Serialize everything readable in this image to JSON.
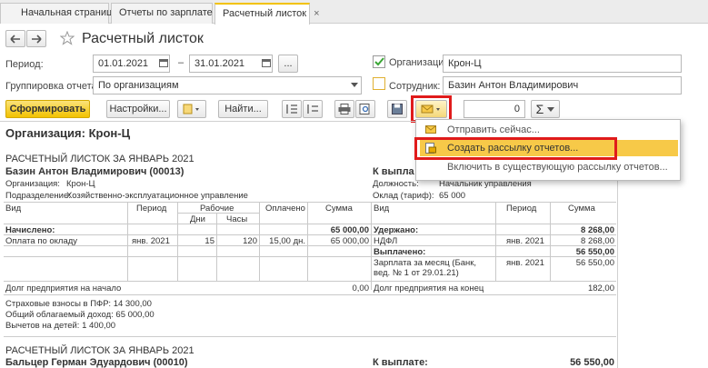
{
  "tabs": [
    {
      "label": "Начальная страница"
    },
    {
      "label": "Отчеты по зарплате"
    },
    {
      "label": "Расчетный листок"
    }
  ],
  "tab_close_glyph": "×",
  "title": "Расчетный листок",
  "form": {
    "period_label": "Период:",
    "date_from": "01.01.2021",
    "dash": "–",
    "date_to": "31.01.2021",
    "ellipsis": "...",
    "grouping_label": "Группировка отчета:",
    "grouping_value": "По организациям",
    "org_label": "Организация:",
    "org_value": "Крон-Ц",
    "org_checked": true,
    "employee_label": "Сотрудник:",
    "employee_value": "Базин Антон Владимирович"
  },
  "toolbar": {
    "generate": "Сформировать",
    "settings": "Настройки...",
    "find": "Найти...",
    "number_value": "0",
    "sigma": "Σ"
  },
  "menu": {
    "items": [
      {
        "label": "Отправить сейчас..."
      },
      {
        "label": "Создать рассылку отчетов..."
      },
      {
        "label": "Включить в существующую рассылку отчетов..."
      }
    ]
  },
  "report": {
    "org_header": "Организация: Крон-Ц",
    "sheet1": {
      "title": "РАСЧЕТНЫЙ ЛИСТОК ЗА ЯНВАРЬ 2021",
      "employee": "Базин Антон Владимирович (00013)",
      "to_pay_label": "К выпла",
      "org_label": "Организация:",
      "org_value": "Крон-Ц",
      "dept_label": "Подразделение:",
      "dept_value": "Хозяйственно-эксплуатационное управление",
      "position_label": "Должность:",
      "position_value": "Начальник управления",
      "salary_label": "Оклад (тариф):",
      "salary_value": "65 000",
      "headers": {
        "kind": "Вид",
        "period": "Период",
        "working": "Рабочие",
        "days": "Дни",
        "hours": "Часы",
        "paid": "Оплачено",
        "sum": "Сумма",
        "kind2": "Вид",
        "period2": "Период",
        "sum2": "Сумма"
      },
      "accrued_label": "Начислено:",
      "accrued_sum": "65 000,00",
      "withheld_label": "Удержано:",
      "withheld_sum": "8 268,00",
      "row1": {
        "kind": "Оплата по окладу",
        "period": "янв. 2021",
        "days": "15",
        "hours": "120",
        "paid": "15,00 дн.",
        "sum": "65 000,00"
      },
      "ndfl": {
        "kind": "НДФЛ",
        "period": "янв. 2021",
        "sum": "8 268,00"
      },
      "paid_label": "Выплачено:",
      "paid_sum": "56 550,00",
      "salary_month_1": "Зарплата за месяц (Банк,",
      "salary_month_2": "вед. № 1 от 29.01.21)",
      "salary_month_period": "янв. 2021",
      "salary_month_sum": "56 550,00",
      "debt_start_label": "Долг предприятия на начало",
      "debt_start_sum": "0,00",
      "debt_end_label": "Долг предприятия на конец",
      "debt_end_sum": "182,00",
      "pfr": "Страховые взносы в ПФР: 14 300,00",
      "taxable": "Общий облагаемый доход: 65 000,00",
      "children": "Вычетов на детей: 1 400,00"
    },
    "sheet2": {
      "title": "РАСЧЕТНЫЙ ЛИСТОК ЗА ЯНВАРЬ 2021",
      "employee": "Бальцер Герман Эдуардович (00010)",
      "to_pay_label": "К выплате:",
      "to_pay_sum": "56 550,00"
    }
  },
  "colors": {
    "accent_yellow": "#f5cf2a",
    "highlight": "#f7c948",
    "red_box": "#e01b1b",
    "tab_accent": "#f2c200"
  }
}
